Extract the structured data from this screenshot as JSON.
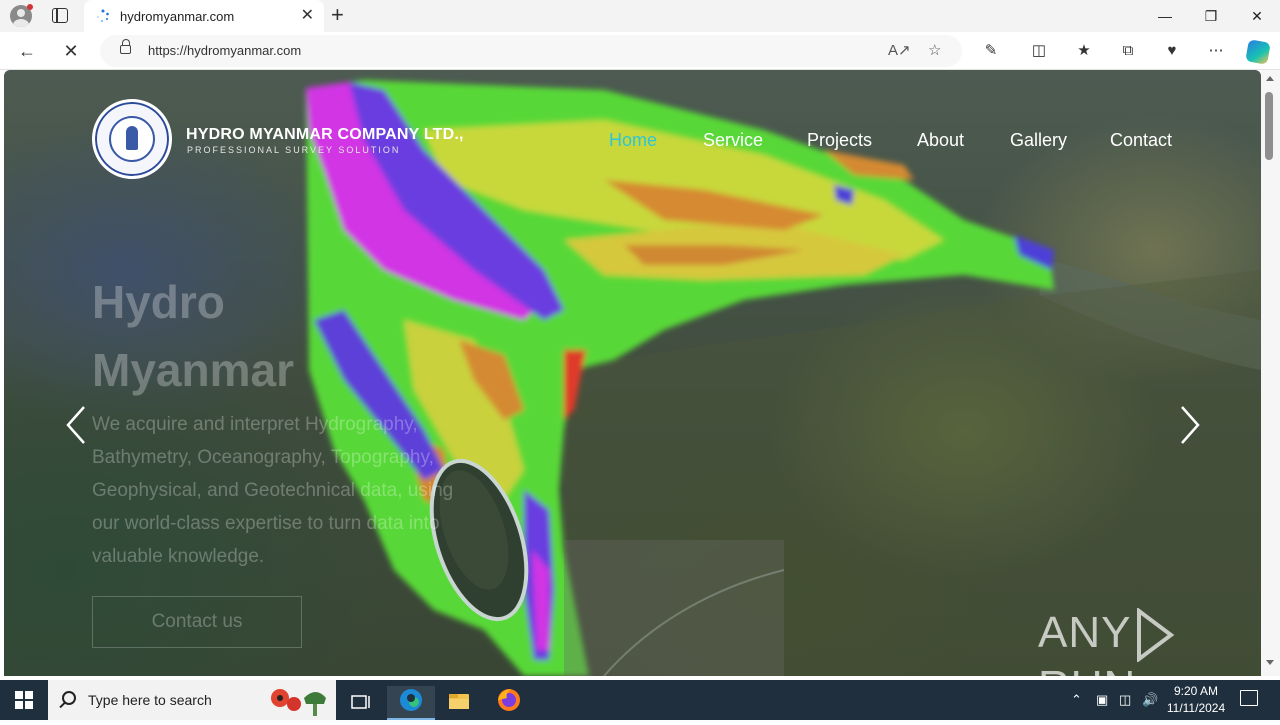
{
  "browser": {
    "tab_title": "hydromyanmar.com",
    "url": "https://hydromyanmar.com",
    "new_tab_symbol": "+",
    "close_tab_symbol": "✕"
  },
  "site": {
    "company_name": "HYDRO MYANMAR COMPANY LTD.,",
    "tagline": "PROFESSIONAL SURVEY SOLUTION",
    "nav": [
      "Home",
      "Service",
      "Projects",
      "About",
      "Gallery",
      "Contact"
    ],
    "active_nav": "Home",
    "hero_title": "Hydro Myanmar",
    "hero_text": "We acquire and interpret Hydrography, Bathymetry, Oceanography, Topography, Geophysical, and Geotechnical data, using our world-class expertise to turn data into valuable knowledge.",
    "hero_button": "Contact us"
  },
  "watermark": {
    "left": "ANY",
    "right": "RUN"
  },
  "taskbar": {
    "search_placeholder": "Type here to search",
    "time": "9:20 AM",
    "date": "11/11/2024"
  },
  "colors": {
    "accent_nav": "#2ec6d6",
    "taskbar": "#1f2f3e"
  }
}
